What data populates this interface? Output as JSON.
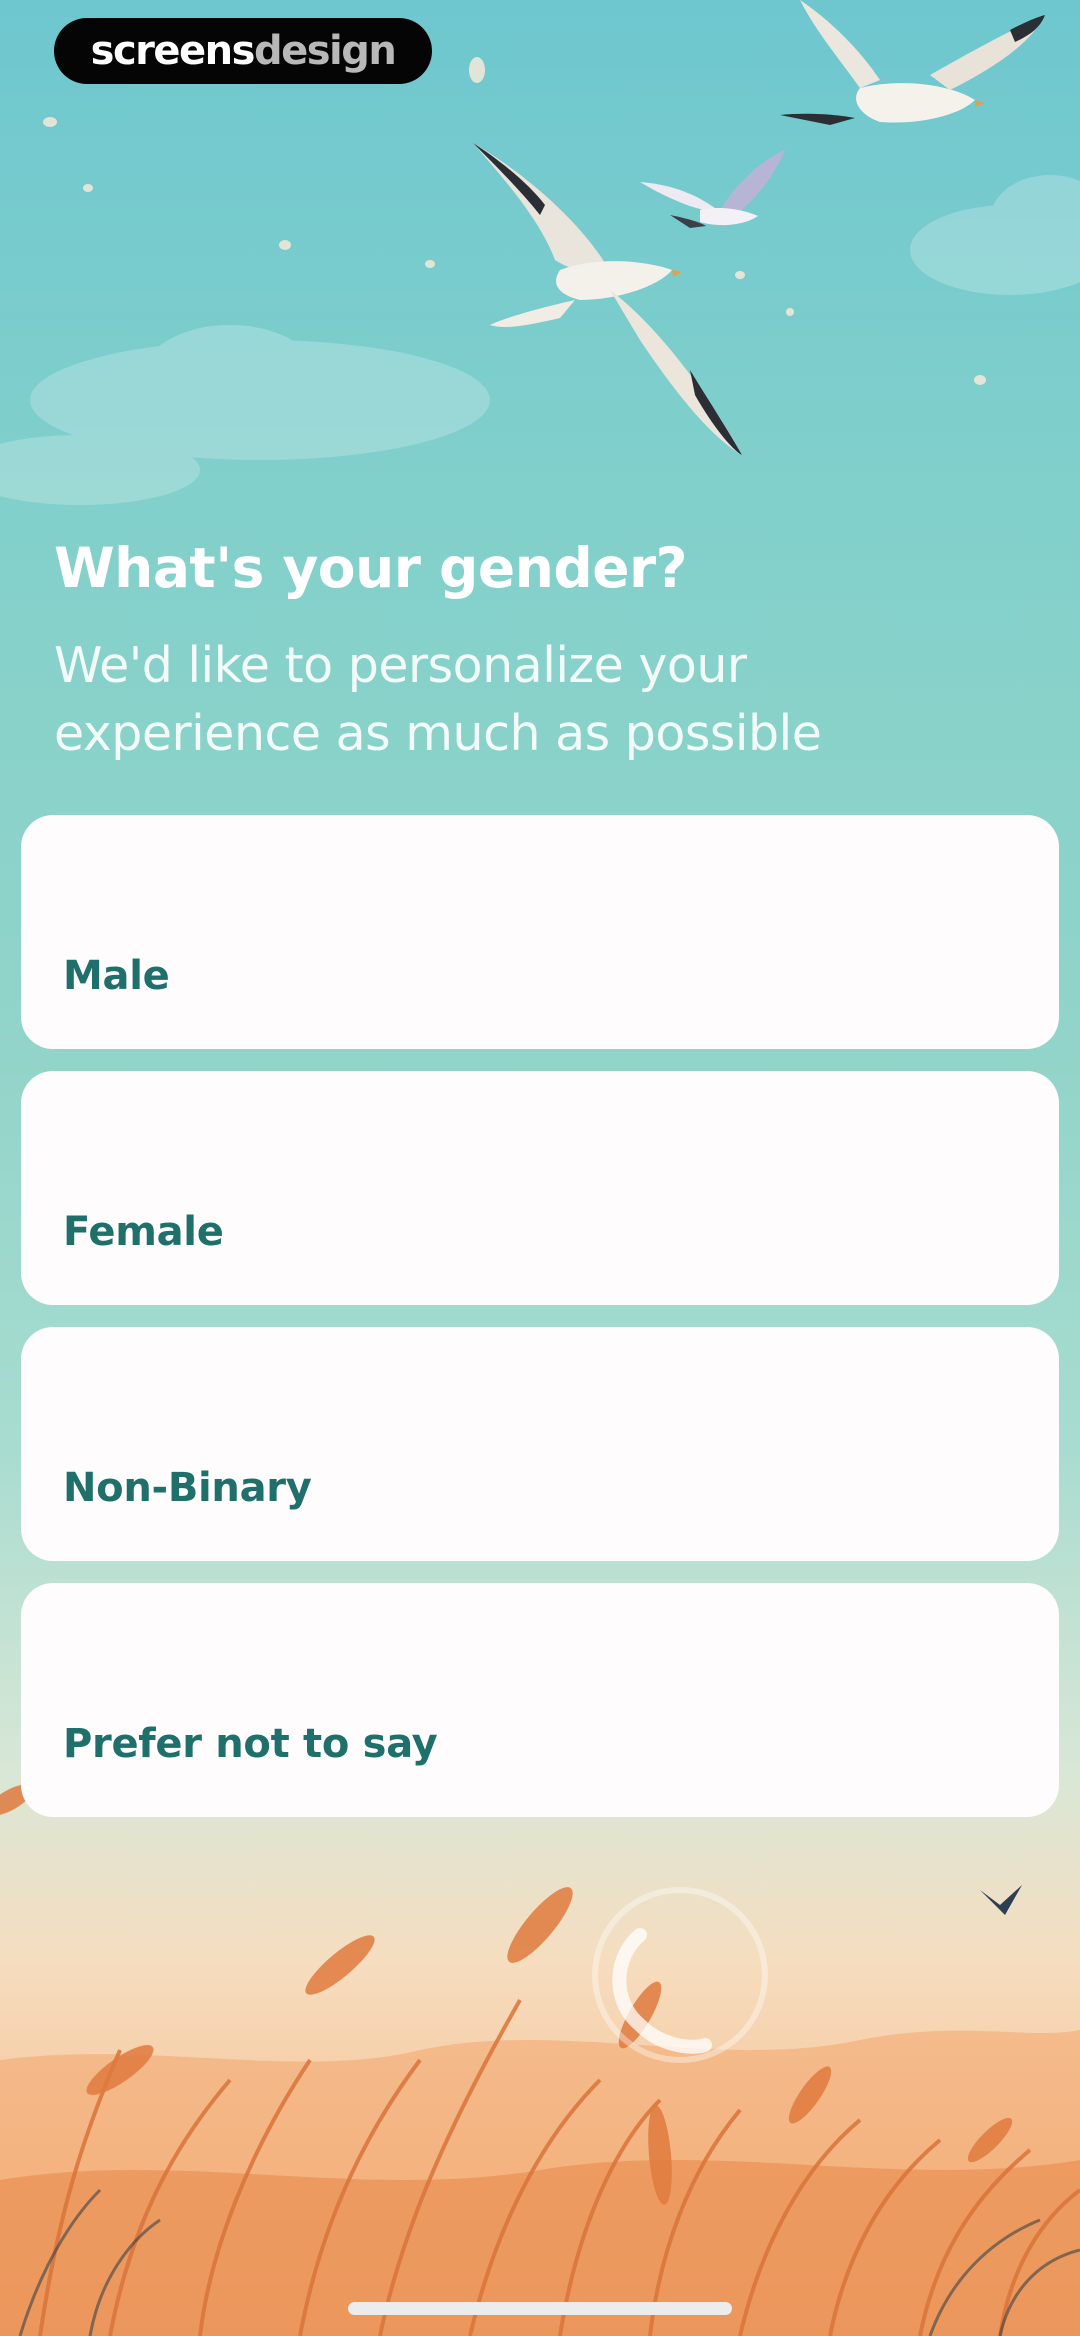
{
  "watermark": {
    "part1": "screens",
    "part2": "design"
  },
  "question": {
    "title": "What's your gender?",
    "subtitle": "We'd like to personalize your experience as much as possible"
  },
  "options": [
    {
      "label": "Male"
    },
    {
      "label": "Female"
    },
    {
      "label": "Non-Binary"
    },
    {
      "label": "Prefer not to say"
    }
  ],
  "theme": {
    "accent": "#1f6f6a",
    "card_background": "#fefcfc",
    "sky_top": "#6ec7cf",
    "field_orange": "#e8894a"
  },
  "icons": [
    "seagull-illustration",
    "reeds-illustration",
    "loading-spinner-icon"
  ]
}
